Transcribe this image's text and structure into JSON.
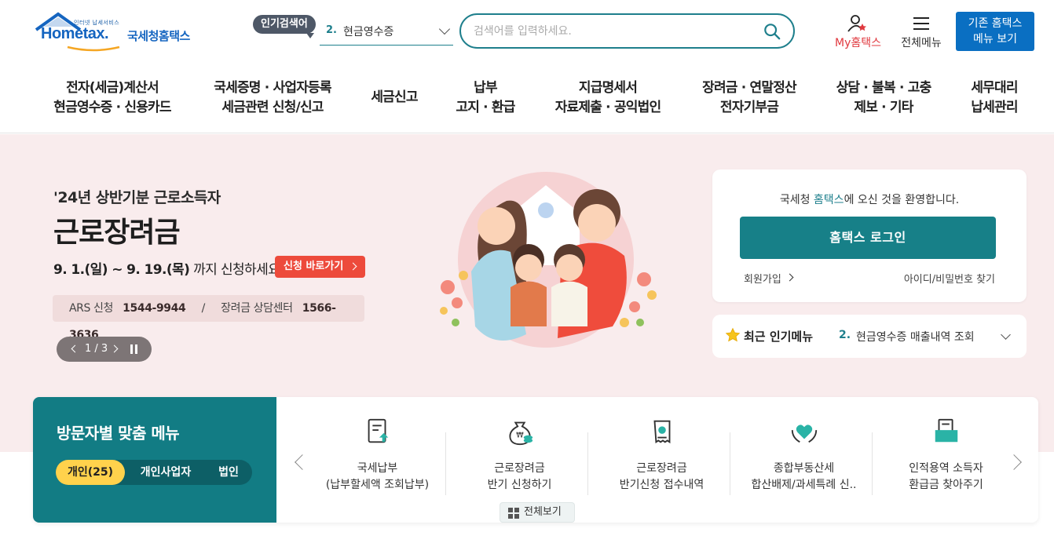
{
  "header": {
    "logo_small": "인터넷 납세서비스",
    "logo_word": "Hometax.",
    "logo_korean": "국세청홈택스",
    "popular_tag": "인기검색어",
    "popular_num": "2.",
    "popular_text": "현금영수증",
    "search_placeholder": "검색어를 입력하세요.",
    "my_hometax": "My홈택스",
    "all_menu": "전체메뉴",
    "old_menu_line1": "기존 홈택스",
    "old_menu_line2": "메뉴 보기"
  },
  "nav": [
    {
      "line1": "전자(세금)계산서",
      "line2": "현금영수증 · 신용카드"
    },
    {
      "line1": "국세증명 · 사업자등록",
      "line2": "세금관련 신청/신고"
    },
    {
      "line1": "세금신고",
      "line2": ""
    },
    {
      "line1": "납부",
      "line2": "고지 · 환급"
    },
    {
      "line1": "지급명세서",
      "line2": "자료제출 · 공익법인"
    },
    {
      "line1": "장려금 · 연말정산",
      "line2": "전자기부금"
    },
    {
      "line1": "상담 · 불복 · 고충",
      "line2": "제보 · 기타"
    },
    {
      "line1": "세무대리",
      "line2": "납세관리"
    }
  ],
  "hero": {
    "subtitle": "'24년 상반기분 근로소득자",
    "title": "근로장려금",
    "date_bold": "9. 1.(일) ~ 9. 19.(목)",
    "date_rest": " 까지 신청하세요!",
    "apply_button": "신청 바로가기",
    "ars_label": "ARS 신청",
    "ars_number": "1544-9944",
    "separator": "/",
    "center_label": "장려금 상담센터",
    "center_number": "1566-3636",
    "slide_indicator": "1 / 3"
  },
  "login": {
    "welcome_pre": "국세청 ",
    "welcome_hl": "홈택스",
    "welcome_post": "에 오신 것을 환영합니다.",
    "login_button": "홈택스 로그인",
    "join": "회원가입",
    "find": "아이디/비밀번호 찾기"
  },
  "recent": {
    "title": "최근 인기메뉴",
    "num": "2.",
    "text": "현금영수증 매출내역 조회"
  },
  "visitor": {
    "title": "방문자별 맞춤 메뉴",
    "tabs": [
      "개인(25)",
      "개인사업자",
      "법인"
    ],
    "services": [
      {
        "line1": "국세납부",
        "line2": "(납부할세액 조회납부)",
        "icon": "tax-document-icon"
      },
      {
        "line1": "근로장려금",
        "line2": "반기 신청하기",
        "icon": "money-bag-icon"
      },
      {
        "line1": "근로장려금",
        "line2": "반기신청 접수내역",
        "icon": "receipt-search-icon"
      },
      {
        "line1": "종합부동산세",
        "line2": "합산배제/과세특례 신..",
        "icon": "heart-hands-icon"
      },
      {
        "line1": "인적용역 소득자",
        "line2": "환급금 찾아주기",
        "icon": "folder-docs-icon"
      }
    ],
    "view_all": "전체보기"
  },
  "colors": {
    "brand": "#1565c0",
    "teal": "#127c84",
    "accent_red": "#ed4a3b",
    "hero_bg": "#f9eced",
    "tab_active": "#ffd24c"
  }
}
